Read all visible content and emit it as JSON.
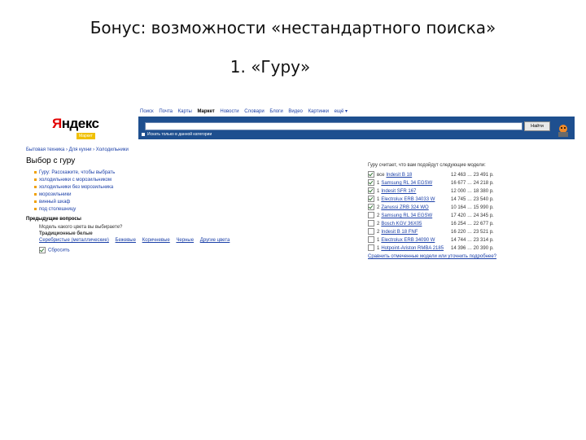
{
  "slide": {
    "title": "Бонус: возможности «нестандартного поиска»",
    "subtitle": "1. «Гуру»"
  },
  "screenshot": {
    "logo": {
      "letter": "Я",
      "rest": "ндекс",
      "badge": "Маркет"
    },
    "nav": [
      "Поиск",
      "Почта",
      "Карты",
      "Маркет",
      "Новости",
      "Словари",
      "Блоги",
      "Видео",
      "Картинки",
      "ещё ▾"
    ],
    "search": {
      "value": "",
      "button_label": "Найти",
      "option_label": "Искать только в данной категории"
    },
    "breadcrumb": "Бытовая техника › Для кухни › Холодильники",
    "page_title": "Выбор с гуру",
    "left_items": [
      {
        "label": "Гуру: Расскажите, чтобы выбрать",
        "kind": "guru"
      },
      {
        "label": "холодильники с морозильником",
        "kind": "link"
      },
      {
        "label": "холодильники без морозильника",
        "kind": "link"
      },
      {
        "label": "морозильники",
        "kind": "link"
      },
      {
        "label": "винный шкаф",
        "kind": "link"
      },
      {
        "label": "под столешницу",
        "kind": "link"
      }
    ],
    "questions_heading": "Предыдущие вопросы",
    "question_text": "Модель какого цвета вы выбираете?",
    "question_answer": "Традиционные белые",
    "answer_links": [
      "Серебристые (металлические)",
      "Бежевые",
      "Коричневые",
      "Черные",
      "Другие цвета"
    ],
    "checkbox_label": "Сбросить",
    "right_heading": "Гуру считает, что вам подойдут следующие модели:",
    "results": [
      {
        "num": "все",
        "name": "Indesit B 18",
        "price": "12 463 … 23 491 р.",
        "checked": true
      },
      {
        "num": "1",
        "name": "Samsung RL 34 EGSW",
        "price": "16 677 … 24 218 р.",
        "checked": true
      },
      {
        "num": "1",
        "name": "Indesit SFR 167",
        "price": "12 000 … 18 380 р.",
        "checked": true
      },
      {
        "num": "1",
        "name": "Electrolux ERB 34033 W",
        "price": "14 745 … 23 540 р.",
        "checked": true
      },
      {
        "num": "2",
        "name": "Zanussi ZRB 324 WO",
        "price": "10 164 … 15 990 р.",
        "checked": true
      },
      {
        "num": "2",
        "name": "Samsung RL 34 EGSW",
        "price": "17 420 … 24 345 р.",
        "checked": false
      },
      {
        "num": "2",
        "name": "Bosch KGV 36X05",
        "price": "16 254 … 22 677 р.",
        "checked": false
      },
      {
        "num": "2",
        "name": "Indesit B 18 FNF",
        "price": "16 220 … 23 521 р.",
        "checked": false
      },
      {
        "num": "1",
        "name": "Electrolux ERB 34090 W",
        "price": "14 744 … 23 314 р.",
        "checked": false
      },
      {
        "num": "1",
        "name": "Hotpoint-Ariston RMBA 2185",
        "price": "14 396 … 20 390 р.",
        "checked": false
      }
    ],
    "compare_link": "Сравнить отмеченные модели или уточнить подробнее?"
  }
}
